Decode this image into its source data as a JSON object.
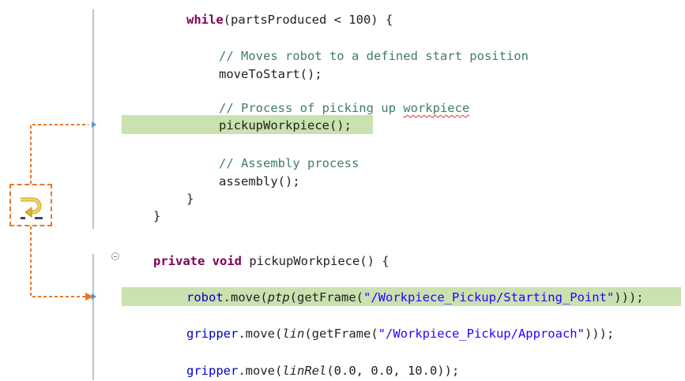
{
  "editor": {
    "lines": [
      {
        "id": "while",
        "parts": [
          {
            "t": "while",
            "c": "kw"
          },
          {
            "t": "(partsProduced < 100) {"
          }
        ]
      },
      {
        "id": "comment-start",
        "parts": [
          {
            "t": "// Moves robot to a defined start position",
            "c": "cm"
          }
        ]
      },
      {
        "id": "move-to-start",
        "parts": [
          {
            "t": "moveToStart();"
          }
        ]
      },
      {
        "id": "comment-pickup",
        "parts": [
          {
            "t": "// Process of picking up ",
            "c": "cm"
          },
          {
            "t": "workpiece",
            "c": "cm squig"
          }
        ]
      },
      {
        "id": "pickup-call",
        "parts": [
          {
            "t": "pickupWorkpiece();"
          }
        ]
      },
      {
        "id": "comment-assembly",
        "parts": [
          {
            "t": "// Assembly process",
            "c": "cm"
          }
        ]
      },
      {
        "id": "assembly-call",
        "parts": [
          {
            "t": "assembly();"
          }
        ]
      },
      {
        "id": "close-while",
        "parts": [
          {
            "t": "}"
          }
        ]
      },
      {
        "id": "close-block",
        "parts": [
          {
            "t": "}"
          }
        ]
      },
      {
        "id": "method-decl",
        "parts": [
          {
            "t": "private",
            "c": "kw"
          },
          {
            "t": " "
          },
          {
            "t": "void",
            "c": "kw"
          },
          {
            "t": " pickupWorkpiece() {"
          }
        ]
      },
      {
        "id": "robot-move",
        "parts": [
          {
            "t": "robot",
            "c": "fld"
          },
          {
            "t": ".move("
          },
          {
            "t": "ptp",
            "c": "it"
          },
          {
            "t": "(getFrame("
          },
          {
            "t": "\"/Workpiece_Pickup/Starting_Point\"",
            "c": "str"
          },
          {
            "t": ")));"
          }
        ]
      },
      {
        "id": "gripper-move-lin",
        "parts": [
          {
            "t": "gripper",
            "c": "fld"
          },
          {
            "t": ".move("
          },
          {
            "t": "lin",
            "c": "it"
          },
          {
            "t": "(getFrame("
          },
          {
            "t": "\"/Workpiece_Pickup/Approach\"",
            "c": "str"
          },
          {
            "t": ")));"
          }
        ]
      },
      {
        "id": "gripper-move-linrel",
        "parts": [
          {
            "t": "gripper",
            "c": "fld"
          },
          {
            "t": ".move("
          },
          {
            "t": "linRel",
            "c": "it"
          },
          {
            "t": "(0.0, 0.0, 10.0));"
          }
        ]
      }
    ]
  },
  "icons": {
    "step_into": "step-into-icon",
    "fold": "fold-collapse-icon"
  },
  "colors": {
    "highlight": "#c9e2b0",
    "arrow": "#e8782a",
    "keyword": "#7f0055",
    "comment": "#3f7f5f",
    "string": "#2a00ff",
    "field": "#0000c0"
  }
}
